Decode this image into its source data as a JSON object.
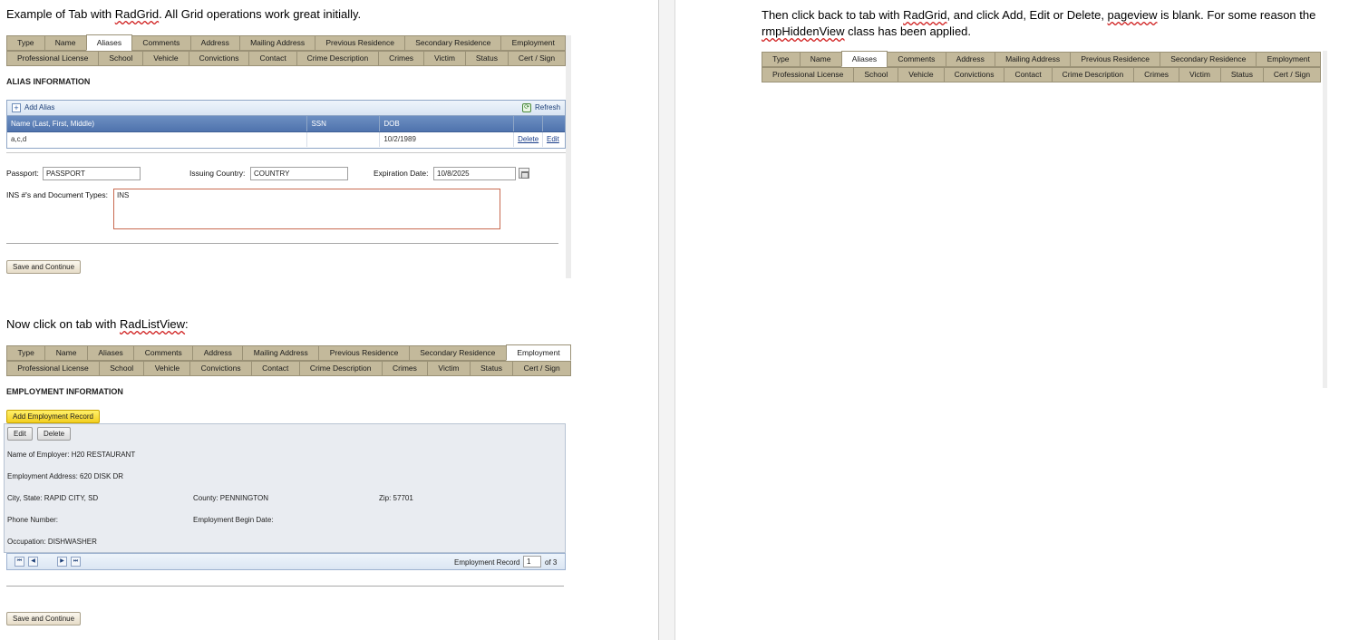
{
  "headings": {
    "top_left_prefix": "Example of Tab with ",
    "top_left_link": "RadGrid",
    "top_left_suffix": ". All Grid operations work great initially.",
    "middle_left_prefix": "Now click on tab with ",
    "middle_left_link": "RadListView",
    "middle_left_suffix": ":",
    "right_p1": "Then click back to tab with ",
    "right_link1": "RadGrid",
    "right_p2": ", and click Add, Edit or Delete, ",
    "right_link2": "pageview",
    "right_p3": " is blank.  For some reason the ",
    "right_link3": "rmpHiddenView",
    "right_p4": " class has been applied."
  },
  "tabs": {
    "row1": [
      "Type",
      "Name",
      "Aliases",
      "Comments",
      "Address",
      "Mailing Address",
      "Previous Residence",
      "Secondary Residence",
      "Employment"
    ],
    "row2": [
      "Professional License",
      "School",
      "Vehicle",
      "Convictions",
      "Contact",
      "Crime Description",
      "Crimes",
      "Victim",
      "Status",
      "Cert / Sign"
    ]
  },
  "alias_section": {
    "title": "ALIAS INFORMATION",
    "add_label": "Add Alias",
    "refresh_label": "Refresh",
    "columns": [
      "Name (Last, First, Middle)",
      "SSN",
      "DOB",
      "",
      ""
    ],
    "rows": [
      {
        "name": "a,c,d",
        "ssn": "",
        "dob": "10/2/1989",
        "delete": "Delete",
        "edit": "Edit"
      }
    ],
    "passport_label": "Passport:",
    "passport_value": "PASSPORT",
    "country_label": "Issuing Country:",
    "country_value": "COUNTRY",
    "expiration_label": "Expiration Date:",
    "expiration_value": "10/8/2025",
    "ins_label": "INS #'s and Document Types:",
    "ins_value": "INS",
    "save_label": "Save and Continue"
  },
  "employment_section": {
    "title": "EMPLOYMENT INFORMATION",
    "add_label": "Add Employment Record",
    "edit_label": "Edit",
    "delete_label": "Delete",
    "employer": "Name of Employer: H20 RESTAURANT",
    "address": "Employment Address: 620 DISK DR",
    "city_state": "City, State: RAPID CITY, SD",
    "county": "County: PENNINGTON",
    "zip": "Zip: 57701",
    "phone": "Phone Number:",
    "begin_date": "Employment Begin Date:",
    "occupation": "Occupation: DISHWASHER",
    "pager_label": "Employment Record",
    "pager_value": "1",
    "pager_total": "of 3",
    "save_label": "Save and Continue"
  },
  "colors": {
    "tab_bg": "#c3b99b",
    "grid_header": "#4f73ad",
    "add_employment": "#f3cf20",
    "listview_bg": "#e9ecf1"
  }
}
